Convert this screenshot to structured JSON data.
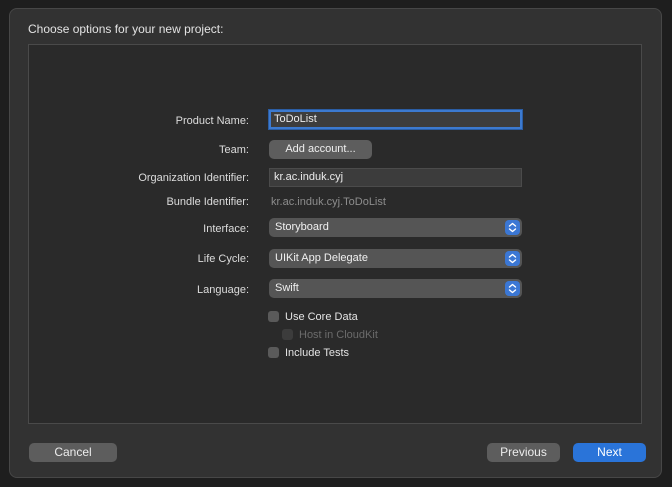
{
  "dialog": {
    "title": "Choose options for your new project:"
  },
  "form": {
    "product_name_label": "Product Name:",
    "product_name_value": "ToDoList",
    "team_label": "Team:",
    "add_account_label": "Add account...",
    "org_id_label": "Organization Identifier:",
    "org_id_value": "kr.ac.induk.cyj",
    "bundle_id_label": "Bundle Identifier:",
    "bundle_id_value": "kr.ac.induk.cyj.ToDoList",
    "interface_label": "Interface:",
    "interface_value": "Storyboard",
    "lifecycle_label": "Life Cycle:",
    "lifecycle_value": "UIKit App Delegate",
    "language_label": "Language:",
    "language_value": "Swift"
  },
  "options": {
    "use_core_data": {
      "label": "Use Core Data",
      "checked": false
    },
    "host_in_cloudkit": {
      "label": "Host in CloudKit",
      "checked": false,
      "enabled": false
    },
    "include_tests": {
      "label": "Include Tests",
      "checked": false
    }
  },
  "footer": {
    "cancel_label": "Cancel",
    "previous_label": "Previous",
    "next_label": "Next"
  },
  "colors": {
    "accent": "#2a74d9",
    "focus_ring": "#3c7ad0"
  }
}
